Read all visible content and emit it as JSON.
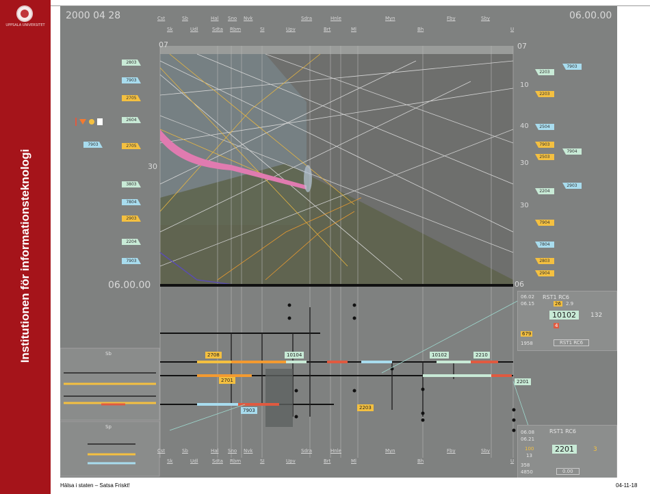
{
  "sidebar": {
    "logo_caption": "UPPSALA UNIVERSITET",
    "title": "Institutionen för informationsteknologi"
  },
  "footer": {
    "left": "Hälsa i staten – Satsa Friskt!",
    "right": "04-11-18"
  },
  "display": {
    "date_time": "2000 04 28",
    "clock": "06.00.00",
    "time_cursor": "06.00.00",
    "scale_top_left": "07",
    "scale_top_right": "07",
    "scale_mid_left": "30",
    "scale_mid_right_1": "30",
    "scale_mid_right_2": "30",
    "scale_bottom_right": "06",
    "scale_right_10": "10",
    "scale_right_40": "40",
    "nav_top_row1": [
      "Cst",
      "Sb",
      "Hal",
      "Sno",
      "Nvk",
      "Sdra",
      "Hnle",
      "Myn",
      "Fby",
      "Sby"
    ],
    "nav_top_row2": [
      "Sk",
      "Udl",
      "Sdta",
      "Rbm",
      "SI",
      "Upv",
      "Brt",
      "Ml",
      "Bh",
      "U"
    ],
    "nav_bottom_row1": [
      "Cst",
      "Sb",
      "Hal",
      "Sno",
      "Nvk",
      "Sdra",
      "Hnle",
      "Myn",
      "Fby",
      "Sby"
    ],
    "nav_bottom_row2": [
      "Sk",
      "Udl",
      "Sdta",
      "Rbm",
      "SI",
      "Upv",
      "Brt",
      "Ml",
      "Bh",
      "U"
    ]
  },
  "left_tags": [
    "2803",
    "7903",
    "2705",
    "2604",
    "7903",
    "2705",
    "3803",
    "7804",
    "2903",
    "2204",
    "7903"
  ],
  "right_tags": [
    "2203",
    "7903",
    "2203",
    "2504",
    "7903",
    "7904",
    "2503",
    "2903",
    "2204",
    "7804",
    "2803",
    "2904",
    "7904"
  ],
  "train_labels": {
    "t1": "2708",
    "t2": "10104",
    "t3": "10102",
    "t4": "2210",
    "t5": "2701",
    "t6": "7903",
    "t7": "2203",
    "t8": "2201"
  },
  "panel_top": {
    "title": "RST1 RC6",
    "time_a": "06.02",
    "time_b": "06.15",
    "num_a": "26",
    "num_b": "2.9",
    "main": "10102",
    "side": "132",
    "small": "4",
    "val_a": "679",
    "val_b": "1958",
    "btn": "RST1 RC6"
  },
  "panel_bottom": {
    "title": "RST1 RC6",
    "time_a": "06.08",
    "time_b": "06.21",
    "num_a": "100",
    "num_b": "13",
    "main": "2201",
    "side": "3",
    "val_a": "358",
    "val_b": "4850",
    "btn": "0.00"
  },
  "mini_map": {
    "label_top": "Sb",
    "label_bottom": "Sp"
  },
  "colors": {
    "brand": "#a5141a",
    "screen": "#7f8180",
    "orange": "#f4c040",
    "green": "#c8ead6",
    "blue": "#a8dcee",
    "pink": "#e07bb0"
  }
}
